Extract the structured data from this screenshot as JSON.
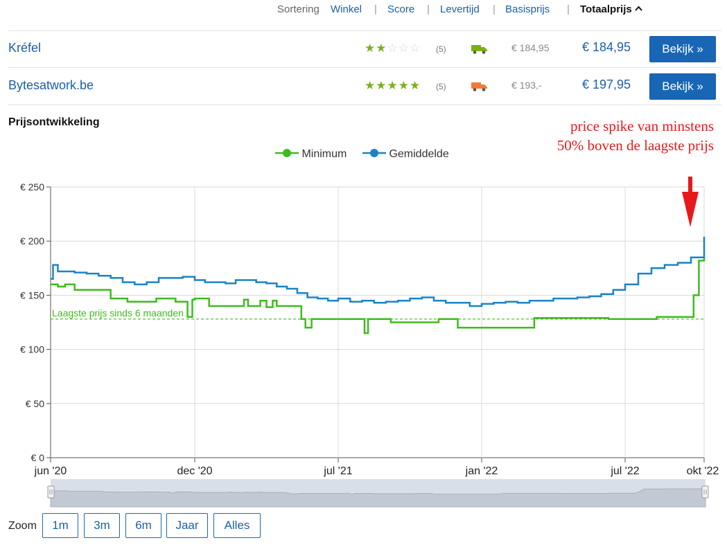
{
  "sortbar": {
    "label": "Sortering",
    "options": [
      "Winkel",
      "Score",
      "Levertijd",
      "Basisprijs"
    ],
    "active": "Totaalprijs",
    "separator": "|"
  },
  "shops": [
    {
      "name": "Kréfel",
      "rating": 2,
      "reviews": "(5)",
      "base_price": "€ 184,95",
      "total_price": "€ 184,95",
      "button": "Bekijk »",
      "truck_color": "#7ab11a"
    },
    {
      "name": "Bytesatwork.be",
      "rating": 5,
      "reviews": "(5)",
      "base_price": "€ 193,-",
      "total_price": "€ 197,95",
      "button": "Bekijk »",
      "truck_color": "#ef7d3a"
    }
  ],
  "section_title": "Prijsontwikkeling",
  "annotation": {
    "line1": "price spike van minstens",
    "line2": "50% boven de laagste prijs",
    "color": "#e8191b"
  },
  "legend": {
    "minimum": "Minimum",
    "gemiddelde": "Gemiddelde"
  },
  "colors": {
    "minimum": "#3dbb1c",
    "gemiddelde": "#1a83c6",
    "accent": "#1867b6"
  },
  "chart_data": {
    "type": "line",
    "x_ticks": [
      "jun '20",
      "dec '20",
      "jul '21",
      "jan '22",
      "jul '22",
      "okt '22"
    ],
    "y_ticks": [
      "€ 0",
      "€ 50",
      "€ 100",
      "€ 150",
      "€ 200",
      "€ 250"
    ],
    "ylim": [
      0,
      250
    ],
    "reference_line": {
      "label": "Laagste prijs sinds 6 maanden",
      "value": 128
    },
    "series": [
      {
        "name": "Minimum",
        "points": [
          [
            0,
            160
          ],
          [
            0.3,
            158
          ],
          [
            0.6,
            160
          ],
          [
            1.0,
            155
          ],
          [
            2.4,
            155
          ],
          [
            2.5,
            147
          ],
          [
            3.2,
            144
          ],
          [
            4.0,
            144
          ],
          [
            4.4,
            147
          ],
          [
            4.8,
            147
          ],
          [
            5.2,
            144
          ],
          [
            5.6,
            144
          ],
          [
            5.7,
            130
          ],
          [
            5.9,
            146
          ],
          [
            6.0,
            147
          ],
          [
            6.6,
            147
          ],
          [
            6.7,
            140
          ],
          [
            8.2,
            140
          ],
          [
            8.4,
            146
          ],
          [
            8.6,
            140
          ],
          [
            9.0,
            140
          ],
          [
            9.2,
            145
          ],
          [
            9.5,
            139
          ],
          [
            9.8,
            145
          ],
          [
            10.0,
            140
          ],
          [
            11.0,
            140
          ],
          [
            11.2,
            128
          ],
          [
            11.4,
            120
          ],
          [
            11.7,
            128
          ],
          [
            14.0,
            128
          ],
          [
            14.1,
            115
          ],
          [
            14.25,
            128
          ],
          [
            15.0,
            128
          ],
          [
            15.2,
            125
          ],
          [
            17.0,
            125
          ],
          [
            17.2,
            128
          ],
          [
            17.8,
            128
          ],
          [
            18.0,
            120
          ],
          [
            21.0,
            120
          ],
          [
            21.2,
            129
          ],
          [
            24.0,
            129
          ],
          [
            24.3,
            128
          ],
          [
            25.0,
            128
          ],
          [
            26.0,
            128
          ],
          [
            26.2,
            130
          ],
          [
            27.4,
            130
          ],
          [
            27.6,
            150
          ],
          [
            27.8,
            182
          ],
          [
            28.6,
            182
          ],
          [
            29.0,
            183
          ],
          [
            30.0,
            183
          ],
          [
            30.5,
            184
          ],
          [
            30.7,
            184.95
          ]
        ]
      },
      {
        "name": "Gemiddelde",
        "points": [
          [
            0,
            165
          ],
          [
            0.1,
            178
          ],
          [
            0.3,
            172
          ],
          [
            1.0,
            171
          ],
          [
            1.5,
            170
          ],
          [
            2.0,
            168
          ],
          [
            2.5,
            166
          ],
          [
            3.0,
            162
          ],
          [
            3.5,
            160
          ],
          [
            4.0,
            162
          ],
          [
            4.5,
            166
          ],
          [
            5.0,
            166
          ],
          [
            5.5,
            167
          ],
          [
            6.0,
            164
          ],
          [
            6.5,
            162
          ],
          [
            7.0,
            162
          ],
          [
            7.5,
            161
          ],
          [
            8.0,
            164
          ],
          [
            8.5,
            164
          ],
          [
            9.0,
            162
          ],
          [
            9.5,
            161
          ],
          [
            10.0,
            158
          ],
          [
            10.5,
            156
          ],
          [
            11.0,
            152
          ],
          [
            11.5,
            148
          ],
          [
            12.0,
            147
          ],
          [
            12.5,
            145
          ],
          [
            13.0,
            147
          ],
          [
            13.5,
            144
          ],
          [
            14.0,
            145
          ],
          [
            14.5,
            143
          ],
          [
            15.0,
            144
          ],
          [
            15.5,
            145
          ],
          [
            16.0,
            147
          ],
          [
            16.5,
            148
          ],
          [
            17.0,
            145
          ],
          [
            17.5,
            143
          ],
          [
            18.0,
            143
          ],
          [
            18.5,
            140
          ],
          [
            19.0,
            142
          ],
          [
            19.5,
            143
          ],
          [
            20.0,
            144
          ],
          [
            20.5,
            143
          ],
          [
            21.0,
            145
          ],
          [
            21.5,
            145
          ],
          [
            22.0,
            147
          ],
          [
            22.5,
            147
          ],
          [
            23.0,
            148
          ],
          [
            23.5,
            149
          ],
          [
            24.0,
            151
          ],
          [
            24.5,
            155
          ],
          [
            25.0,
            160
          ],
          [
            25.5,
            170
          ],
          [
            26.0,
            175
          ],
          [
            26.5,
            178
          ],
          [
            27.0,
            180
          ],
          [
            27.5,
            185
          ],
          [
            28.0,
            192
          ],
          [
            28.5,
            196
          ],
          [
            29.0,
            198
          ],
          [
            29.5,
            200
          ],
          [
            30.0,
            204
          ],
          [
            30.2,
            190
          ],
          [
            30.5,
            192
          ],
          [
            30.7,
            190
          ]
        ]
      }
    ],
    "navigator": true,
    "grid": "both"
  },
  "zoom": {
    "label": "Zoom",
    "buttons": [
      "1m",
      "3m",
      "6m",
      "Jaar",
      "Alles"
    ]
  }
}
